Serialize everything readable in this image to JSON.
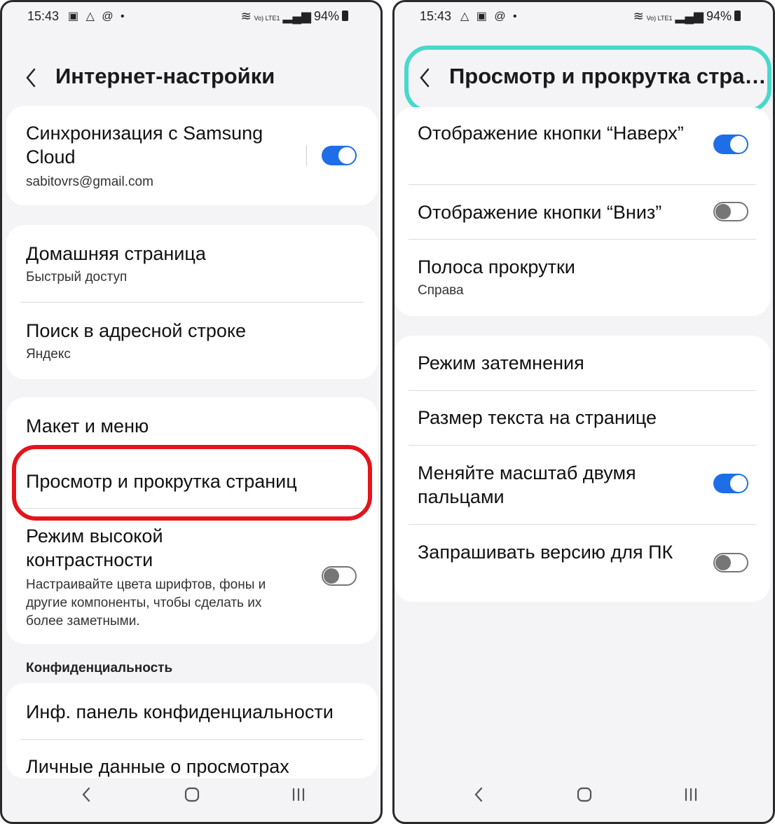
{
  "left": {
    "status": {
      "time": "15:43",
      "icons_left": "▣ △ @ •",
      "signal_text": "Vo) LTE1",
      "battery": "94%"
    },
    "header": {
      "title": "Интернет-настройки"
    },
    "sync": {
      "title": "Синхронизация с Samsung Cloud",
      "email": "sabitovrs@gmail.com",
      "enabled": true
    },
    "home": {
      "title": "Домашняя страница",
      "subtitle": "Быстрый доступ"
    },
    "search": {
      "title": "Поиск в адресной строке",
      "subtitle": "Яндекс"
    },
    "layout": {
      "title": "Макет и меню"
    },
    "view_scroll": {
      "title": "Просмотр и прокрутка страниц"
    },
    "contrast": {
      "title": "Режим высокой контрастности",
      "description": "Настраивайте цвета шрифтов, фоны и другие компоненты, чтобы сделать их более заметными.",
      "enabled": false
    },
    "privacy": {
      "section": "Конфиденциальность",
      "dashboard": "Инф. панель конфиденциальности",
      "browsing_data": "Личные данные о просмотрах"
    }
  },
  "right": {
    "status": {
      "time": "15:43",
      "icons_left": "△ ▣ @ •",
      "signal_text": "Vo) LTE1",
      "battery": "94%"
    },
    "header": {
      "title": "Просмотр и прокрутка страниц"
    },
    "top_button": {
      "title": "Отображение кнопки “Наверх”",
      "enabled": true
    },
    "bottom_button": {
      "title": "Отображение кнопки “Вниз”",
      "enabled": false
    },
    "scrollbar": {
      "title": "Полоса прокрутки",
      "subtitle": "Справа"
    },
    "dim_mode": {
      "title": "Режим затемнения"
    },
    "text_size": {
      "title": "Размер текста на странице"
    },
    "pinch_zoom": {
      "title": "Меняйте масштаб двумя пальцами",
      "enabled": true
    },
    "desktop": {
      "title": "Запрашивать версию для ПК",
      "enabled": false
    }
  },
  "colors": {
    "accent": "#1e6ee8",
    "highlight_red": "#e4141b",
    "highlight_teal": "#47d9cb",
    "background": "#f4f3f5"
  },
  "icons": {
    "back": "chevron-left-icon",
    "nav_back": "nav-back-icon",
    "nav_home": "nav-home-icon",
    "nav_recent": "nav-recent-icon"
  }
}
